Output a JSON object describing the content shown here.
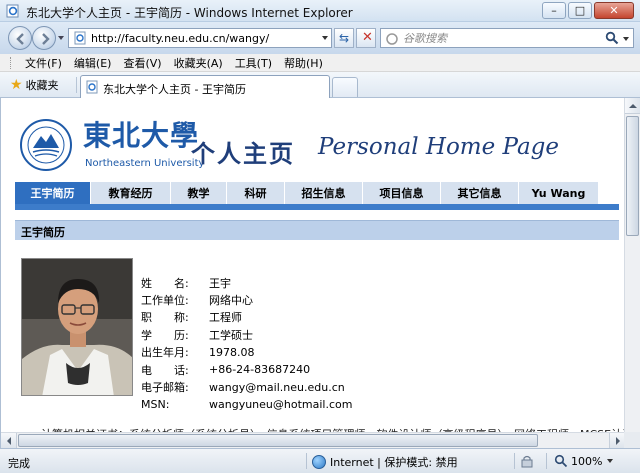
{
  "window": {
    "title": "东北大学个人主页 - 王宇简历 - Windows Internet Explorer"
  },
  "address_bar": {
    "url": "http://faculty.neu.edu.cn/wangy/",
    "search_placeholder": "谷歌搜索"
  },
  "menu": [
    "文件(F)",
    "编辑(E)",
    "查看(V)",
    "收藏夹(A)",
    "工具(T)",
    "帮助(H)"
  ],
  "favorites": {
    "label": "收藏夹"
  },
  "tab": {
    "label": "东北大学个人主页 - 王宇简历"
  },
  "site": {
    "logo_cn": "東北大學",
    "logo_en": "Northeastern University",
    "home_cn": "个人主页",
    "home_en": "Personal Home Page",
    "nav": [
      {
        "label": "王宇简历",
        "active": true
      },
      {
        "label": "教育经历",
        "active": false
      },
      {
        "label": "教学",
        "active": false
      },
      {
        "label": "科研",
        "active": false
      },
      {
        "label": "招生信息",
        "active": false
      },
      {
        "label": "项目信息",
        "active": false
      },
      {
        "label": "其它信息",
        "active": false
      },
      {
        "label": "Yu Wang",
        "active": false
      }
    ],
    "section_title": "王宇简历"
  },
  "profile": {
    "rows": [
      {
        "label": "姓　　名:",
        "value": "王宇"
      },
      {
        "label": "工作单位:",
        "value": "网络中心"
      },
      {
        "label": "职　　称:",
        "value": "工程师"
      },
      {
        "label": "学　　历:",
        "value": "工学硕士"
      },
      {
        "label": "出生年月:",
        "value": "1978.08"
      },
      {
        "label": "电　　话:",
        "value": "+86-24-83687240"
      },
      {
        "label": "电子邮箱:",
        "value": "wangy@mail.neu.edu.cn"
      },
      {
        "label": "MSN:",
        "value": "wangyuneu@hotmail.com"
      }
    ],
    "bio_partial": "计算机相关证书：系统分析师（系统分析员）、信息系统项目管理师、软件设计师（高级程序员）、网络工程师、MCSE认证工程"
  },
  "status": {
    "text": "完成",
    "zone": "Internet | 保护模式: 禁用",
    "zoom": "100%"
  },
  "colors": {
    "nav_active": "#2f6fc0",
    "nav_inactive": "#d6e1ef",
    "section_bar": "#bcd0ea",
    "brand_blue": "#1e5aa8"
  }
}
